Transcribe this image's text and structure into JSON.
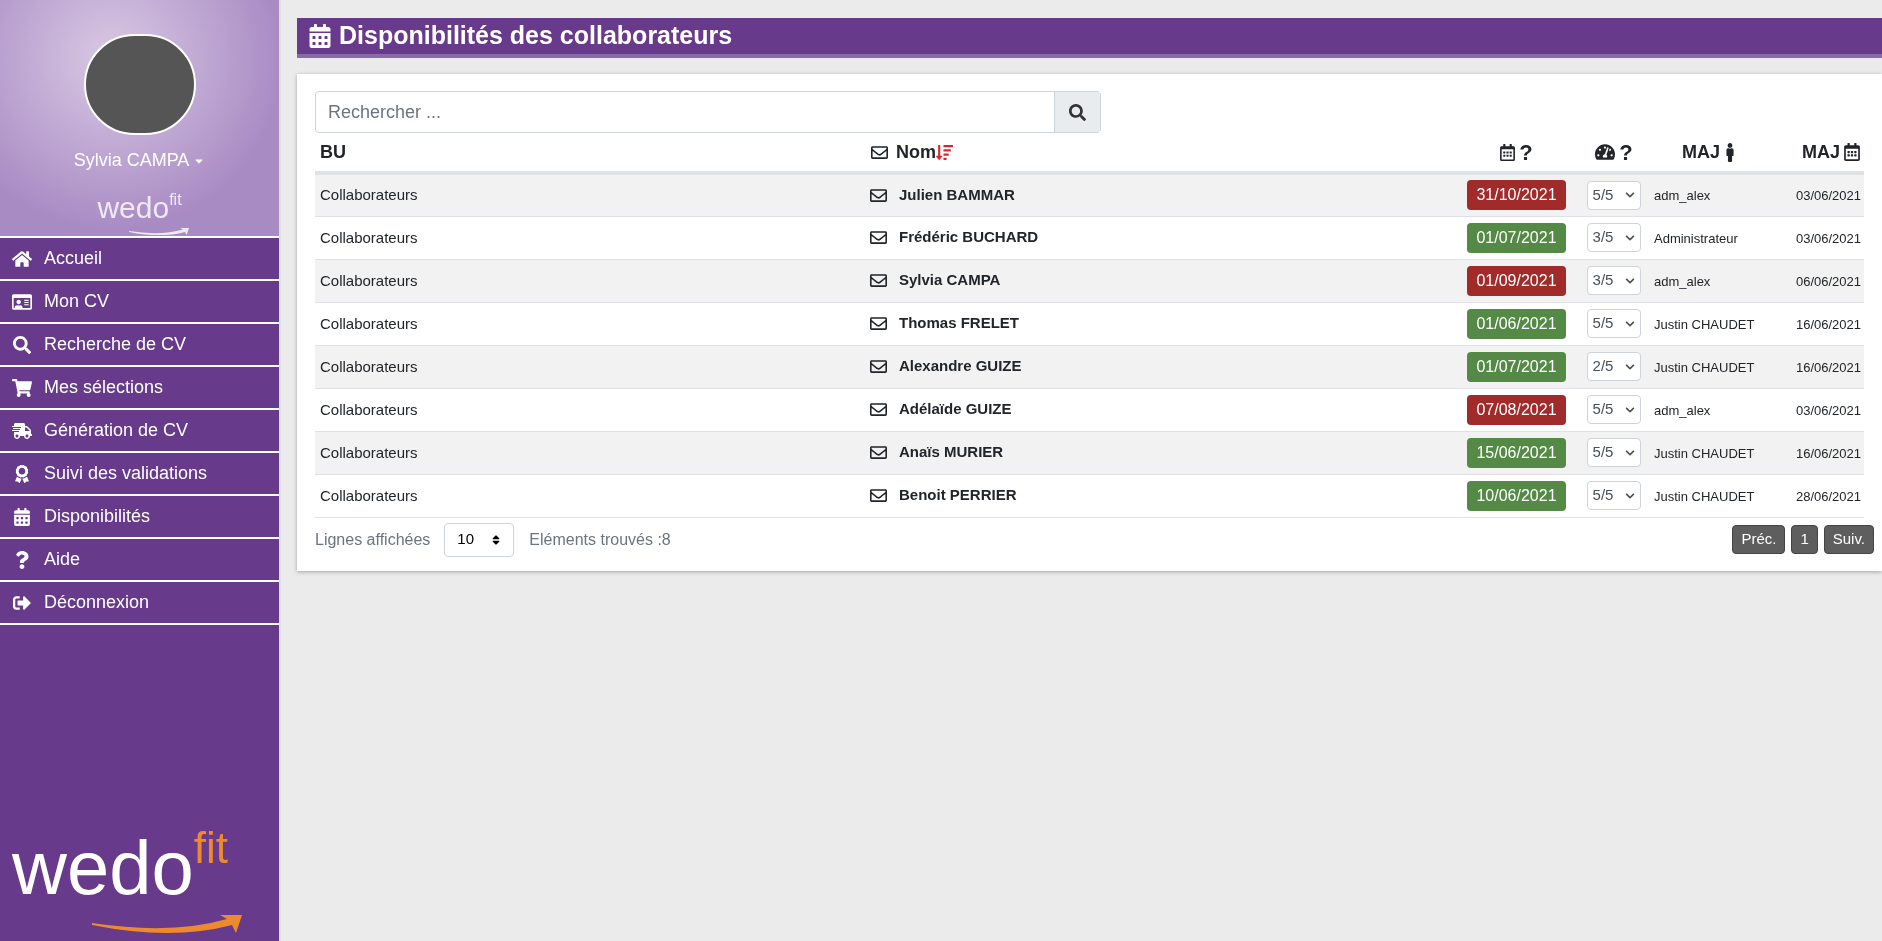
{
  "sidebar": {
    "user": {
      "name": "Sylvia CAMPA"
    },
    "logo_small": {
      "main": "wedo",
      "accent": "fit"
    },
    "items": [
      {
        "label": "Accueil",
        "selected": false
      },
      {
        "label": "Mon CV",
        "selected": false
      },
      {
        "label": "Recherche de CV",
        "selected": false
      },
      {
        "label": "Mes sélections",
        "selected": false
      },
      {
        "label": "Génération de CV",
        "selected": false
      },
      {
        "label": "Suivi des validations",
        "selected": false
      },
      {
        "label": "Disponibilités",
        "selected": false
      },
      {
        "label": "Aide",
        "selected": false
      },
      {
        "label": "Déconnexion",
        "selected": false
      }
    ],
    "logo_large": {
      "main": "wedo",
      "accent": "fit"
    }
  },
  "page": {
    "title": "Disponibilités des collaborateurs"
  },
  "search": {
    "placeholder": "Rechercher ..."
  },
  "table": {
    "columns": {
      "bu": "BU",
      "name": "Nom",
      "availability": "?",
      "level": "?",
      "updated_by": "MAJ",
      "updated_on": "MAJ"
    },
    "rows": [
      {
        "bu": "Collaborateurs",
        "name": "Julien BAMMAR",
        "availability": "31/10/2021",
        "color": "#a12a2a",
        "level": "5/5",
        "updated_by": "adm_alex",
        "updated_on": "03/06/2021"
      },
      {
        "bu": "Collaborateurs",
        "name": "Frédéric BUCHARD",
        "availability": "01/07/2021",
        "color": "#548a45",
        "level": "3/5",
        "updated_by": "Administrateur",
        "updated_on": "03/06/2021"
      },
      {
        "bu": "Collaborateurs",
        "name": "Sylvia CAMPA",
        "availability": "01/09/2021",
        "color": "#a12a2a",
        "level": "3/5",
        "updated_by": "adm_alex",
        "updated_on": "06/06/2021"
      },
      {
        "bu": "Collaborateurs",
        "name": "Thomas FRELET",
        "availability": "01/06/2021",
        "color": "#548a45",
        "level": "5/5",
        "updated_by": "Justin CHAUDET",
        "updated_on": "16/06/2021"
      },
      {
        "bu": "Collaborateurs",
        "name": "Alexandre GUIZE",
        "availability": "01/07/2021",
        "color": "#548a45",
        "level": "2/5",
        "updated_by": "Justin CHAUDET",
        "updated_on": "16/06/2021"
      },
      {
        "bu": "Collaborateurs",
        "name": "Adélaïde GUIZE",
        "availability": "07/08/2021",
        "color": "#a12a2a",
        "level": "5/5",
        "updated_by": "adm_alex",
        "updated_on": "03/06/2021"
      },
      {
        "bu": "Collaborateurs",
        "name": "Anaïs MURIER",
        "availability": "15/06/2021",
        "color": "#548a45",
        "level": "5/5",
        "updated_by": "Justin CHAUDET",
        "updated_on": "16/06/2021"
      },
      {
        "bu": "Collaborateurs",
        "name": "Benoit PERRIER",
        "availability": "10/06/2021",
        "color": "#548a45",
        "level": "5/5",
        "updated_by": "Justin CHAUDET",
        "updated_on": "28/06/2021"
      }
    ]
  },
  "footer": {
    "rows_label": "Lignes affichées",
    "rows_value": "10",
    "found": "Eléments trouvés :8",
    "pagination": [
      {
        "label": "Préc.",
        "selected": false
      },
      {
        "label": "1",
        "selected": false
      },
      {
        "label": "Suiv.",
        "selected": false
      }
    ]
  }
}
